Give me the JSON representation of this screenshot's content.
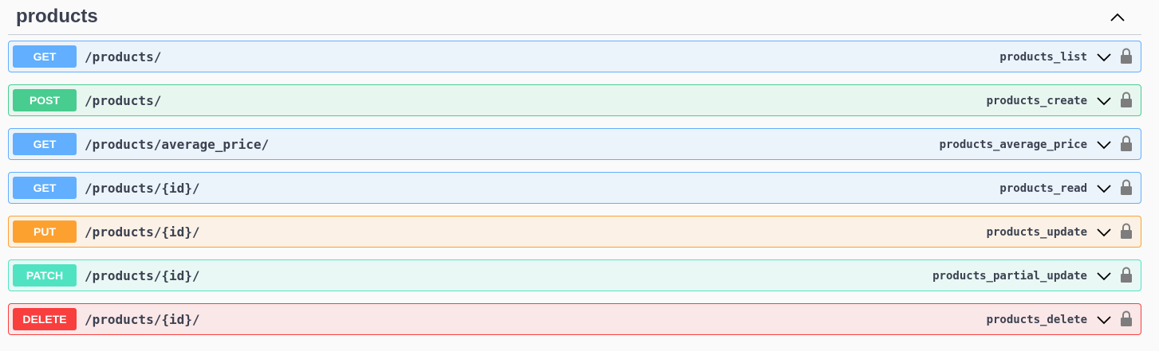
{
  "tag": {
    "title": "products"
  },
  "operations": [
    {
      "method": "GET",
      "path": "/products/",
      "operation_id": "products_list",
      "color": "#61affe",
      "bg": "#ebf3fb"
    },
    {
      "method": "POST",
      "path": "/products/",
      "operation_id": "products_create",
      "color": "#49cc90",
      "bg": "#e8f6f0"
    },
    {
      "method": "GET",
      "path": "/products/average_price/",
      "operation_id": "products_average_price",
      "color": "#61affe",
      "bg": "#ebf3fb"
    },
    {
      "method": "GET",
      "path": "/products/{id}/",
      "operation_id": "products_read",
      "color": "#61affe",
      "bg": "#ebf3fb"
    },
    {
      "method": "PUT",
      "path": "/products/{id}/",
      "operation_id": "products_update",
      "color": "#fca130",
      "bg": "#fbf1e6"
    },
    {
      "method": "PATCH",
      "path": "/products/{id}/",
      "operation_id": "products_partial_update",
      "color": "#50e3c2",
      "bg": "#e9f8f5"
    },
    {
      "method": "DELETE",
      "path": "/products/{id}/",
      "operation_id": "products_delete",
      "color": "#f93e3e",
      "bg": "#fae7e7"
    }
  ],
  "icons": {
    "collapse": "chevron-up-icon",
    "expand": "chevron-down-icon",
    "lock": "lock-icon"
  }
}
